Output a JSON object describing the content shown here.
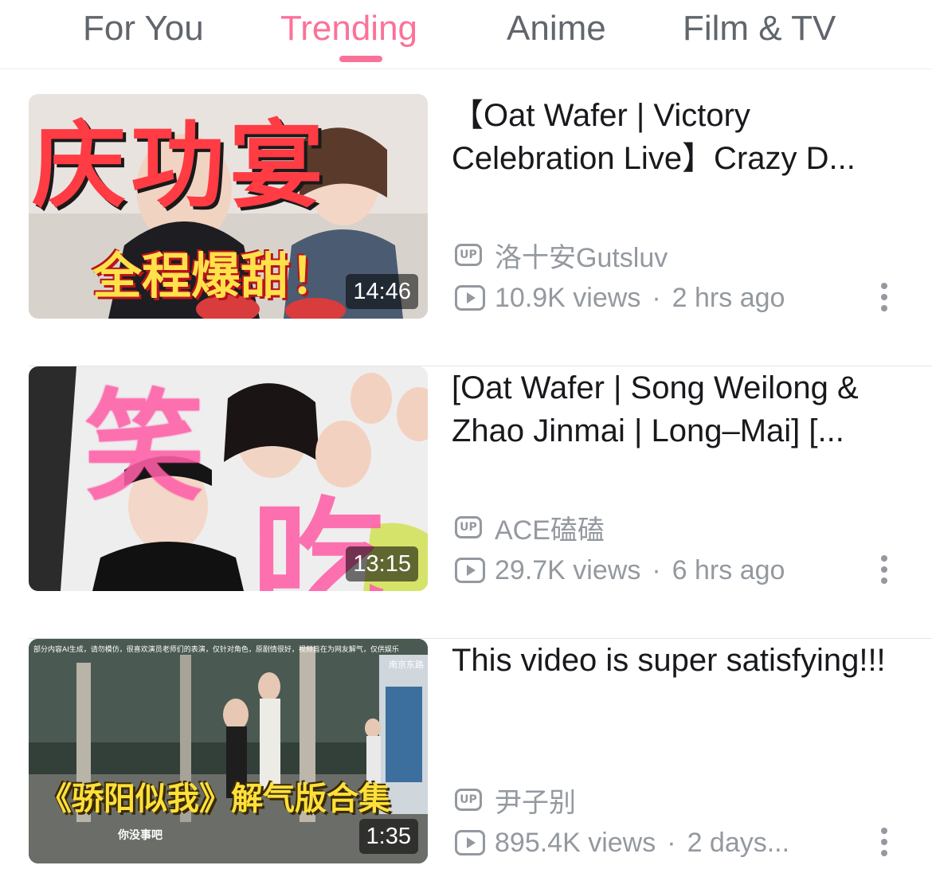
{
  "tabs": [
    {
      "label": "For You",
      "active": false
    },
    {
      "label": "Trending",
      "active": true
    },
    {
      "label": "Anime",
      "active": false
    },
    {
      "label": "Film & TV",
      "active": false
    }
  ],
  "accent_color": "#fb7299",
  "meta_color": "#9499a0",
  "icons": {
    "uploader": "up-badge-icon",
    "views": "play-count-icon",
    "more": "more-vertical-icon"
  },
  "videos": [
    {
      "title": "【Oat Wafer | Victory Celebration Live】Crazy D...",
      "uploader": "洛十安Gutsluv",
      "views": "10.9K views",
      "separator": "·",
      "time": "2 hrs ago",
      "duration": "14:46",
      "thumb_text": [
        "庆功宴",
        "全程爆甜！"
      ]
    },
    {
      "title": "[Oat Wafer | Song Weilong & Zhao Jinmai | Long–Mai] [...",
      "uploader": "ACE磕磕",
      "views": "29.7K views",
      "separator": "·",
      "time": "6 hrs ago",
      "duration": "13:15",
      "thumb_text": [
        "笑",
        "吃"
      ]
    },
    {
      "title": "This video is super satisfying!!!",
      "uploader": "尹子别",
      "views": "895.4K views",
      "separator": "·",
      "time": "2 days...",
      "duration": "1:35",
      "thumb_text": [
        "部分内容AI生成，请勿模仿，很喜欢演员老师们的表演，仅针对角色，原剧情很好，视频旨在为网友解气，仅供娱乐",
        "南京东路",
        "《骄阳似我》解气版合集",
        "你没事吧"
      ]
    }
  ],
  "up_label": "UP"
}
